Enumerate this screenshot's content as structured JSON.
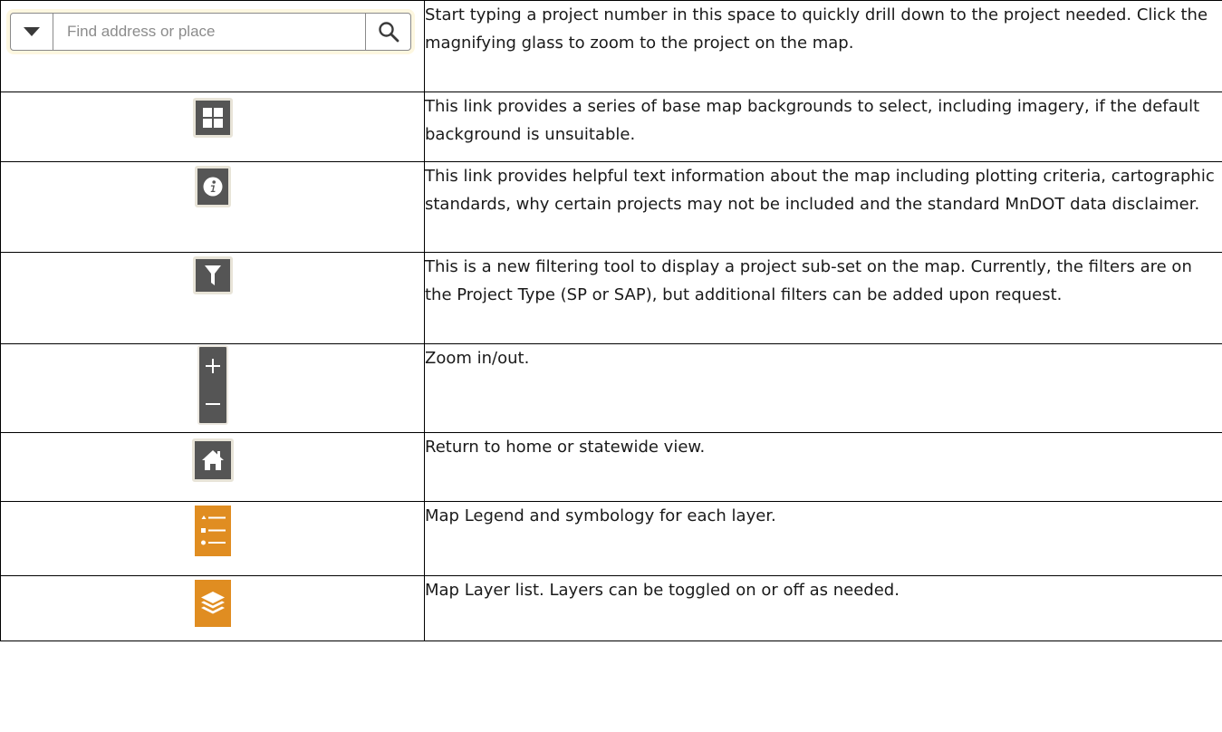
{
  "search": {
    "placeholder": "Find address or place"
  },
  "rows": [
    {
      "icon": "search-widget",
      "description": "Start typing a project number in this space to quickly drill down to the project needed. Click the magnifying glass to zoom to the project on the map."
    },
    {
      "icon": "basemap-gallery-icon",
      "description": "This link provides a series of base map backgrounds to select, including imagery, if the default background is unsuitable."
    },
    {
      "icon": "info-icon",
      "description": "This link provides helpful text information about the map including plotting criteria, cartographic standards, why certain projects may not be included and the standard MnDOT data disclaimer."
    },
    {
      "icon": "filter-icon",
      "description": "This is a new filtering tool to display a project sub-set on the map. Currently, the filters are on the Project Type (SP or SAP), but additional filters can be added upon request."
    },
    {
      "icon": "zoom-in-out-icon",
      "description": "Zoom in/out."
    },
    {
      "icon": "home-icon",
      "description": "Return to home or statewide view."
    },
    {
      "icon": "legend-icon",
      "description": "Map Legend and symbology for each layer."
    },
    {
      "icon": "layer-list-icon",
      "description": "Map Layer list. Layers can be toggled on or off as needed."
    }
  ],
  "colors": {
    "button_dark": "#555555",
    "button_orange": "#e08d21",
    "border": "#000000"
  }
}
